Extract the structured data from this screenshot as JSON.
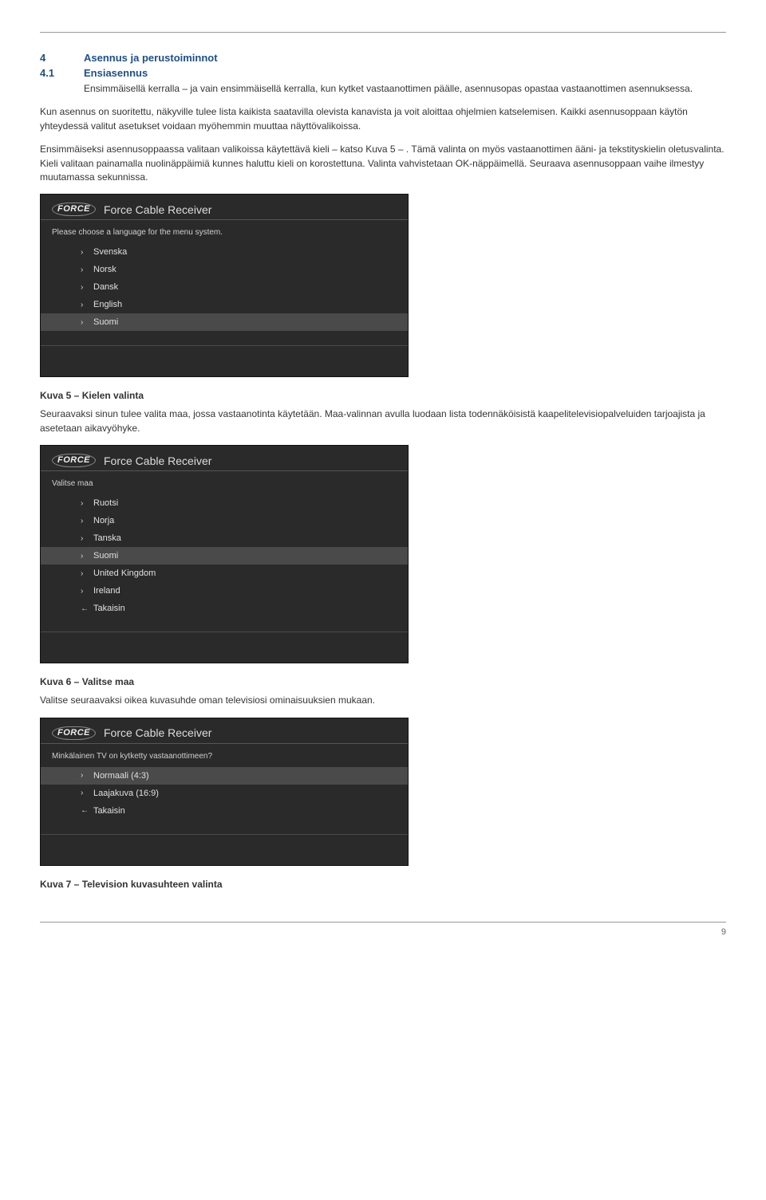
{
  "section": {
    "num": "4",
    "title": "Asennus ja perustoiminnot"
  },
  "subsection": {
    "num": "4.1",
    "title": "Ensiasennus"
  },
  "para1": "Ensimmäisellä kerralla – ja vain ensimmäisellä kerralla, kun kytket vastaanottimen päälle, asennusopas opastaa vastaanottimen asennuksessa.",
  "para2": "Kun asennus on suoritettu, näkyville tulee lista kaikista saatavilla olevista kanavista ja voit aloittaa ohjelmien katselemisen. Kaikki asennusoppaan käytön yhteydessä valitut asetukset voidaan myöhemmin muuttaa näyttövalikoissa.",
  "para3": "Ensimmäiseksi asennusoppaassa valitaan valikoissa käytettävä kieli – katso Kuva 5 – . Tämä valinta on myös vastaanottimen ääni- ja tekstityskielin oletusvalinta. Kieli valitaan painamalla nuolinäppäimiä kunnes haluttu kieli on korostettuna. Valinta vahvistetaan OK-näppäimellä. Seuraava asennusoppaan vaihe ilmestyy muutamassa sekunnissa.",
  "screenshot_title": "Force Cable Receiver",
  "force_logo": "FORCE",
  "ss1": {
    "prompt": "Please choose a language for the menu system.",
    "items": [
      "Svenska",
      "Norsk",
      "Dansk",
      "English",
      "Suomi"
    ],
    "selected_index": 4
  },
  "cap1": "Kuva 5 – Kielen valinta",
  "para4": "Seuraavaksi sinun tulee valita maa, jossa vastaanotinta käytetään. Maa-valinnan avulla luodaan lista todennäköisistä kaapelitelevisiopalveluiden tarjoajista ja asetetaan aikavyöhyke.",
  "ss2": {
    "prompt": "Valitse maa",
    "items": [
      "Ruotsi",
      "Norja",
      "Tanska",
      "Suomi",
      "United Kingdom",
      "Ireland"
    ],
    "selected_index": 3,
    "back": "Takaisin"
  },
  "cap2": "Kuva 6 – Valitse maa",
  "para5": "Valitse seuraavaksi oikea kuvasuhde oman televisiosi ominaisuuksien mukaan.",
  "ss3": {
    "prompt": "Minkälainen TV on kytketty vastaanottimeen?",
    "items": [
      "Normaali (4:3)",
      "Laajakuva (16:9)"
    ],
    "selected_index": 0,
    "back": "Takaisin"
  },
  "cap3": "Kuva 7 – Television kuvasuhteen valinta",
  "page_num": "9"
}
